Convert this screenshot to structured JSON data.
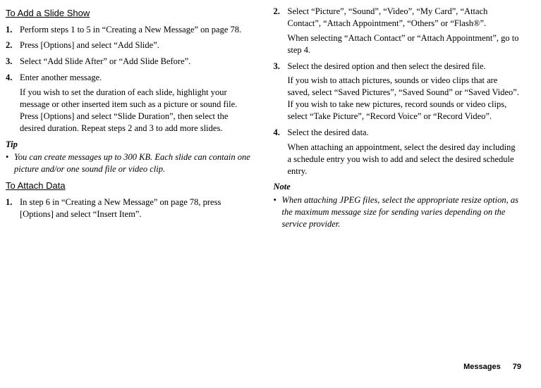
{
  "left": {
    "section1": {
      "title": "To Add a Slide Show",
      "items": [
        {
          "num": "1.",
          "text": "Perform steps 1 to 5 in “Creating a New Message” on page 78."
        },
        {
          "num": "2.",
          "text": "Press [Options] and select “Add Slide”."
        },
        {
          "num": "3.",
          "text": "Select “Add Slide After” or “Add Slide Before”."
        },
        {
          "num": "4.",
          "text": "Enter another message.",
          "sub": "If you wish to set the duration of each slide, highlight your message or other inserted item such as a picture or sound file. Press [Options] and select “Slide Duration”, then select the desired duration. Repeat steps 2 and 3 to add more slides."
        }
      ]
    },
    "tip": {
      "label": "Tip",
      "bullets": [
        "You can create messages up to 300 KB. Each slide can contain one picture and/or one sound file or video clip."
      ]
    },
    "section2": {
      "title": "To Attach Data",
      "items": [
        {
          "num": "1.",
          "text": "In step 6 in “Creating a New Message” on page 78, press [Options] and select “Insert Item”."
        }
      ]
    }
  },
  "right": {
    "items": [
      {
        "num": "2.",
        "text": "Select “Picture”, “Sound”, “Video”, “My Card”, “Attach Contact”, “Attach Appointment”, “Others” or “Flash®”.",
        "sub": "When selecting “Attach Contact” or “Attach Appointment”, go to step 4."
      },
      {
        "num": "3.",
        "text": "Select the desired option and then select the desired file.",
        "sub": "If you wish to attach pictures, sounds or video clips that are saved, select “Saved Pictures”, “Saved Sound” or “Saved Video”.\nIf you wish to take new pictures, record sounds or video clips, select “Take Picture”, “Record Voice” or “Record Video”."
      },
      {
        "num": "4.",
        "text": "Select the desired data.",
        "sub": "When attaching an appointment, select the desired day including a schedule entry you wish to add and select the desired schedule entry."
      }
    ],
    "note": {
      "label": "Note",
      "bullets": [
        "When attaching JPEG files, select the appropriate resize option, as the maximum message size for sending varies depending on the service provider."
      ]
    }
  },
  "footer": {
    "label": "Messages",
    "page": "79"
  }
}
